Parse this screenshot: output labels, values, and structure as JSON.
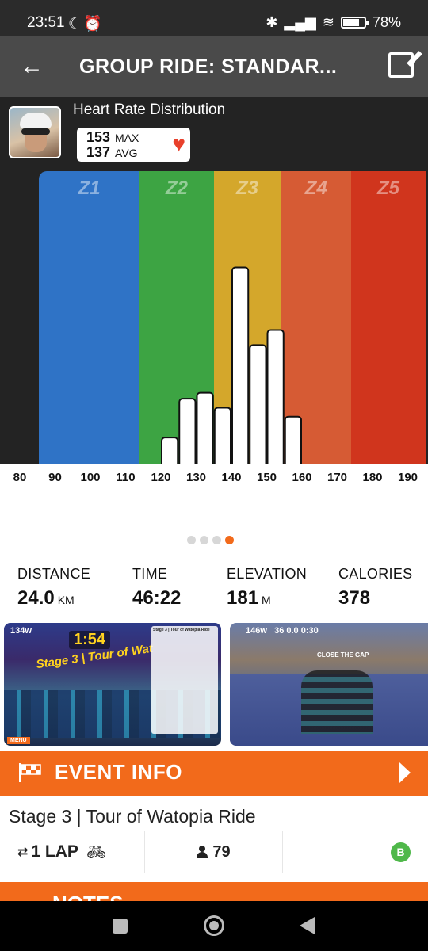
{
  "status_bar": {
    "time": "23:51",
    "left_icons": [
      "moon-icon",
      "alarm-icon"
    ],
    "right_icons": [
      "bluetooth-icon",
      "signal-icon",
      "wifi-icon"
    ],
    "battery_percent_text": "78%",
    "battery_level": 0.78
  },
  "app_bar": {
    "title": "GROUP RIDE: STANDAR...",
    "back_icon": "arrow-left-icon",
    "edit_icon": "edit-icon"
  },
  "heart_rate": {
    "title": "Heart Rate Distribution",
    "max_value": "153",
    "max_label": "MAX",
    "avg_value": "137",
    "avg_label": "AVG",
    "heart_icon": "heart-icon",
    "heart_color": "#e8402b"
  },
  "chart_data": {
    "type": "bar",
    "title": "Heart Rate Distribution",
    "xlabel": "",
    "ylabel": "",
    "x_ticks": [
      "80",
      "90",
      "100",
      "110",
      "120",
      "130",
      "140",
      "150",
      "160",
      "170",
      "180",
      "190"
    ],
    "bins": [
      {
        "from": 120,
        "to": 125,
        "value": 9
      },
      {
        "from": 125,
        "to": 130,
        "value": 22
      },
      {
        "from": 130,
        "to": 135,
        "value": 24
      },
      {
        "from": 135,
        "to": 140,
        "value": 19
      },
      {
        "from": 140,
        "to": 145,
        "value": 66
      },
      {
        "from": 145,
        "to": 150,
        "value": 40
      },
      {
        "from": 150,
        "to": 155,
        "value": 45
      },
      {
        "from": 155,
        "to": 160,
        "value": 16
      }
    ],
    "ylim": [
      0,
      98
    ],
    "zones": [
      {
        "name": "Z1",
        "from": 85,
        "to": 114,
        "color": "#2f73c6"
      },
      {
        "name": "Z2",
        "from": 114,
        "to": 135,
        "color": "#3da443"
      },
      {
        "name": "Z3",
        "from": 135,
        "to": 154,
        "color": "#d4a72b"
      },
      {
        "name": "Z4",
        "from": 154,
        "to": 174,
        "color": "#d65b34"
      },
      {
        "name": "Z5",
        "from": 174,
        "to": 195,
        "color": "#d0351d"
      }
    ]
  },
  "pager": {
    "count": 4,
    "active": 3
  },
  "stats": [
    {
      "label": "DISTANCE",
      "value": "24.0",
      "unit": "KM"
    },
    {
      "label": "TIME",
      "value": "46:22",
      "unit": ""
    },
    {
      "label": "ELEVATION",
      "value": "181",
      "unit": "M"
    },
    {
      "label": "CALORIES",
      "value": "378",
      "unit": ""
    }
  ],
  "screenshots": {
    "shot1": {
      "power": "134w",
      "timer": "1:54",
      "banner": "Stage 3 | Tour of Wat",
      "panel_title": "Stage 3 | Tour of Watopia Ride",
      "menu": "MENU"
    },
    "shot2": {
      "power": "146w",
      "hud_values": "36 0.0 0:30",
      "gap_text": "CLOSE THE GAP"
    }
  },
  "event_info": {
    "label": "EVENT INFO",
    "icon": "checkered-flag-icon",
    "arrow_icon": "chevron-right-icon"
  },
  "ride": {
    "name": "Stage 3 | Tour of Watopia Ride",
    "laps": "1 LAP",
    "laps_icon": "loop-icon",
    "bike_icon": "bike-icon",
    "riders": "79",
    "riders_icon": "person-icon",
    "category": "B",
    "category_color": "#4fb84a"
  },
  "notes": {
    "label": "NOTES"
  },
  "nav": {
    "recent_icon": "square-icon",
    "home_icon": "circle-icon",
    "back_icon": "triangle-back-icon"
  }
}
